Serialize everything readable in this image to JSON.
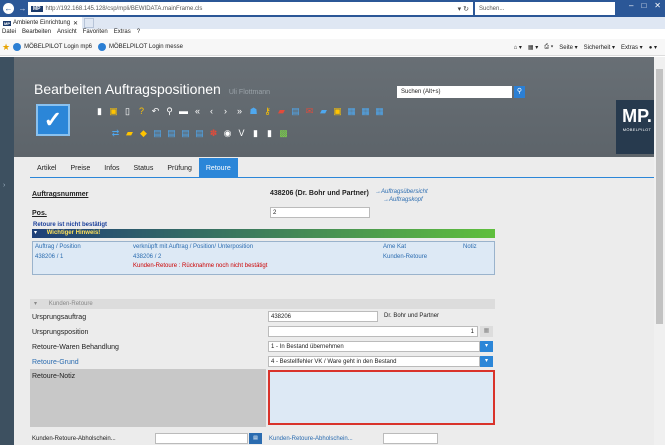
{
  "browser": {
    "url": "http://192.168.145.128/csp/mpli/BEWIDATA.mainFrame.cls",
    "search_placeholder": "Suchen...",
    "tab_title": "Ambiente Einrichtung",
    "menu": [
      "Datei",
      "Bearbeiten",
      "Ansicht",
      "Favoriten",
      "Extras",
      "?"
    ],
    "favorites": [
      "MÖBELPILOT Login mp6",
      "MÖBELPILOT Login messe"
    ],
    "command_items": [
      "Seite ▾",
      "Sicherheit ▾",
      "Extras ▾"
    ]
  },
  "app": {
    "title": "Bearbeiten Auftragspositionen",
    "user": "Uli Flottmann",
    "search_placeholder": "Suchen (Alt+s)",
    "logo_text": "MÖBELPILOT",
    "tabs": [
      "Artikel",
      "Preise",
      "Infos",
      "Status",
      "Prüfung",
      "Retoure"
    ],
    "active_tab": "Retoure"
  },
  "content": {
    "auftragsnummer_label": "Auftragsnummer",
    "auftragsnummer_value": "438206 (Dr. Bohr und Partner)",
    "link_uebersicht": "→Auftragsübersicht",
    "link_kopf": "→Auftragskopf",
    "pos_label": "Pos.",
    "pos_value": "2",
    "retoure_status": "Retoure ist nicht bestätigt",
    "hinweis": "Wichtiger Hinweis!",
    "grid": {
      "h1": "Auftrag / Position",
      "h2": "verknüpft mit Auftrag / Position/ Unterposition",
      "h3": "Ame Kat",
      "h4": "Notiz",
      "v1": "438206 / 1",
      "v2": "438206 / 2",
      "v3": "Kunden-Retoure",
      "warning": "Kunden-Retoure : Rücknahme noch nicht bestätigt"
    },
    "section_title": "Kunden-Retoure",
    "ursprungsauftrag_label": "Ursprungsauftrag",
    "ursprungsauftrag_value": "438206",
    "ursprungsauftrag_name": "Dr. Bohr und Partner",
    "ursprungsposition_label": "Ursprungsposition",
    "ursprungsposition_value": "1",
    "behandlung_label": "Retoure-Waren Behandlung",
    "behandlung_value": "1 - In Bestand übernehmen",
    "grund_label": "Retoure-Grund",
    "grund_value": "4 - Bestellfehler VK / Ware geht in den Bestand",
    "notiz_label": "Retoure-Notiz",
    "abholschein_label": "Kunden-Retoure-Abholschein...",
    "abholschein_link": "Kunden-Retoure-Abholschein..."
  }
}
